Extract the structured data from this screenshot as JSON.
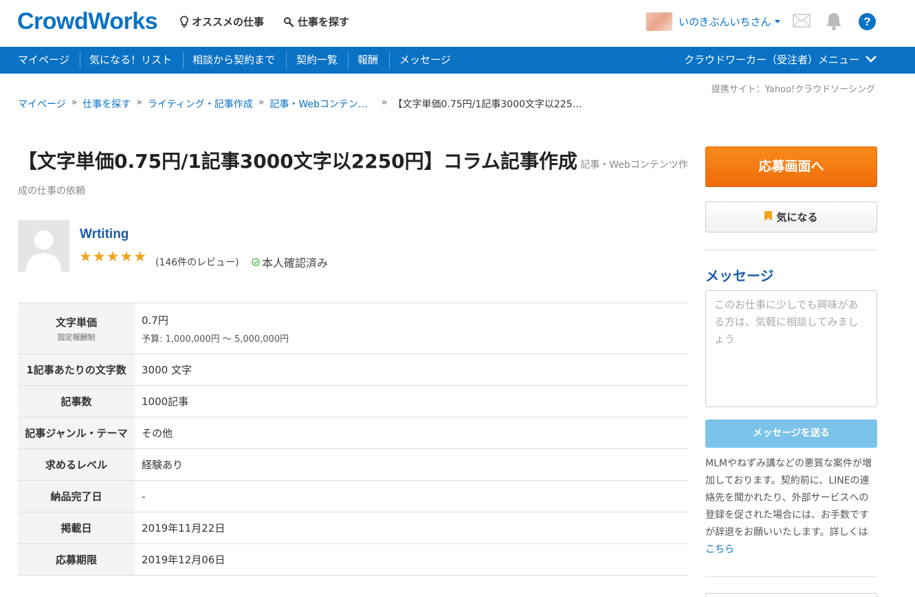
{
  "header": {
    "logo": "CrowdWorks",
    "links": [
      "オススメの仕事",
      "仕事を探す"
    ],
    "username": "いのきぶんいちさん",
    "help": "?"
  },
  "nav": {
    "items": [
      "マイページ",
      "気になる！リスト",
      "相談から契約まで",
      "契約一覧",
      "報酬",
      "メッセージ"
    ],
    "menu": "クラウドワーカー（受注者）メニュー"
  },
  "provider": "提携サイト：Yahoo!クラウドソーシング",
  "breadcrumb": [
    "マイページ",
    "仕事を探す",
    "ライティング・記事作成",
    "記事・Webコンテン…",
    "【文字単価0.75円/1記事3000文字以225…"
  ],
  "breadcrumb_sep": "»",
  "job": {
    "title": "【文字単価0.75円/1記事3000文字以2250円】コラム記事作成",
    "category": "記事・Webコンテンツ作成の仕事の依頼"
  },
  "client": {
    "name": "Wrtiting",
    "rating": 5,
    "star": "★",
    "reviews": "(146件のレビュー)",
    "verified": "本人確認済み"
  },
  "details": {
    "unit_label": "文字単価",
    "unit_sub": "固定報酬制",
    "unit_value": "0.7円",
    "budget": "予算: 1,000,000円 〜 5,000,000円",
    "rows": [
      {
        "label": "1記事あたりの文字数",
        "value": "3000 文字"
      },
      {
        "label": "記事数",
        "value": "1000記事"
      },
      {
        "label": "記事ジャンル・テーマ",
        "value": "その他"
      },
      {
        "label": "求めるレベル",
        "value": "経験あり"
      },
      {
        "label": "納品完了日",
        "value": "-"
      },
      {
        "label": "掲載日",
        "value": "2019年11月22日"
      },
      {
        "label": "応募期限",
        "value": "2019年12月06日"
      }
    ]
  },
  "sidebar": {
    "apply": "応募画面へ",
    "favorite": "気になる",
    "message_title": "メッセージ",
    "message_placeholder": "このお仕事に少しでも興味がある方は、気軽に相談してみましょう",
    "send": "メッセージを送る",
    "warning": "MLMやねずみ講などの悪質な案件が増加しております。契約前に、LINEの連絡先を聞かれたり、外部サービスへの登録を促された場合には、お手数ですが辞退をお願いいたします。詳しくは",
    "warning_link": "こちら"
  },
  "colors": {
    "brand": "#0a72c5",
    "apply": "#f27a10",
    "star": "#f5a21b",
    "send": "#7cc3ea"
  }
}
